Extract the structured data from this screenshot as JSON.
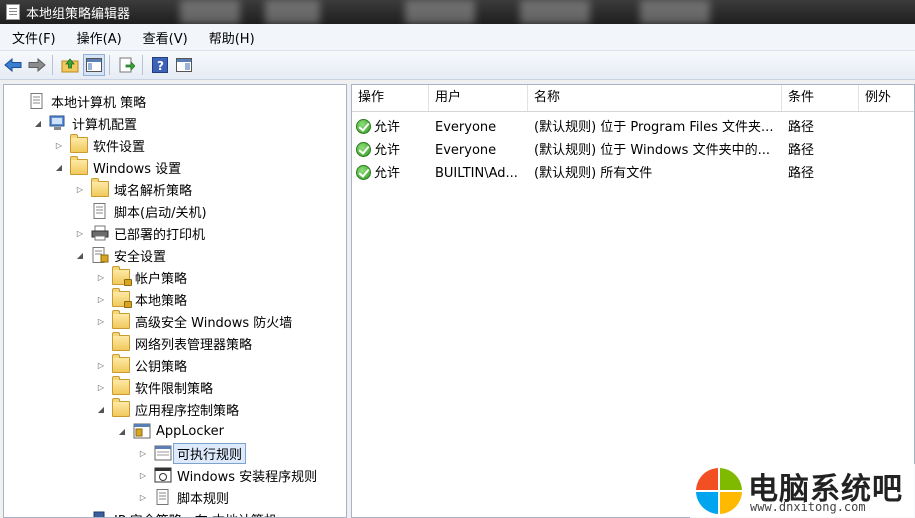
{
  "window": {
    "title": "本地组策略编辑器"
  },
  "menu": [
    "文件(F)",
    "操作(A)",
    "查看(V)",
    "帮助(H)"
  ],
  "toolbar_icons": [
    "back-arrow-icon",
    "forward-arrow-icon",
    "up-folder-icon",
    "show-hide-tree-icon",
    "export-list-icon",
    "help-icon",
    "properties-icon"
  ],
  "tree": [
    {
      "label": "本地计算机 策略",
      "level": 0,
      "expander": "",
      "icon": "policy-doc-icon"
    },
    {
      "label": "计算机配置",
      "level": 1,
      "expander": "expanded",
      "icon": "computer-icon"
    },
    {
      "label": "软件设置",
      "level": 2,
      "expander": "collapsed",
      "icon": "folder-icon"
    },
    {
      "label": "Windows 设置",
      "level": 2,
      "expander": "expanded",
      "icon": "folder-icon"
    },
    {
      "label": "域名解析策略",
      "level": 3,
      "expander": "collapsed",
      "icon": "folder-icon"
    },
    {
      "label": "脚本(启动/关机)",
      "level": 3,
      "expander": "",
      "icon": "script-icon"
    },
    {
      "label": "已部署的打印机",
      "level": 3,
      "expander": "collapsed",
      "icon": "printer-icon"
    },
    {
      "label": "安全设置",
      "level": 3,
      "expander": "expanded",
      "icon": "security-settings-icon"
    },
    {
      "label": "帐户策略",
      "level": 4,
      "expander": "collapsed",
      "icon": "locked-folder-icon"
    },
    {
      "label": "本地策略",
      "level": 4,
      "expander": "collapsed",
      "icon": "locked-folder-icon"
    },
    {
      "label": "高级安全 Windows 防火墙",
      "level": 4,
      "expander": "collapsed",
      "icon": "folder-icon"
    },
    {
      "label": "网络列表管理器策略",
      "level": 4,
      "expander": "",
      "icon": "folder-icon"
    },
    {
      "label": "公钥策略",
      "level": 4,
      "expander": "collapsed",
      "icon": "folder-icon"
    },
    {
      "label": "软件限制策略",
      "level": 4,
      "expander": "collapsed",
      "icon": "folder-icon"
    },
    {
      "label": "应用程序控制策略",
      "level": 4,
      "expander": "expanded",
      "icon": "folder-icon"
    },
    {
      "label": "AppLocker",
      "level": 5,
      "expander": "expanded",
      "icon": "applocker-icon"
    },
    {
      "label": "可执行规则",
      "level": 6,
      "expander": "collapsed",
      "icon": "executable-rules-icon",
      "selected": true
    },
    {
      "label": "Windows 安装程序规则",
      "level": 6,
      "expander": "collapsed",
      "icon": "installer-rules-icon"
    },
    {
      "label": "脚本规则",
      "level": 6,
      "expander": "collapsed",
      "icon": "script-rules-icon"
    },
    {
      "label": "IP 安全策略，在 本地计算机",
      "level": 3,
      "expander": "collapsed",
      "icon": "ip-security-icon"
    }
  ],
  "table": {
    "columns": [
      "操作",
      "用户",
      "名称",
      "条件",
      "例外"
    ],
    "rows": [
      {
        "action": "允许",
        "user": "Everyone",
        "name": "(默认规则) 位于 Program Files 文件夹...",
        "condition": "路径",
        "exception": ""
      },
      {
        "action": "允许",
        "user": "Everyone",
        "name": "(默认规则) 位于 Windows 文件夹中的...",
        "condition": "路径",
        "exception": ""
      },
      {
        "action": "允许",
        "user": "BUILTIN\\Ad...",
        "name": "(默认规则) 所有文件",
        "condition": "路径",
        "exception": ""
      }
    ]
  },
  "watermark": {
    "title": "电脑系统吧",
    "url": "www.dnxitong.com"
  },
  "colors": {
    "allow_icon": "#2f9a22",
    "selection": "#dceafc",
    "title_bar": "#2a2a2a"
  }
}
